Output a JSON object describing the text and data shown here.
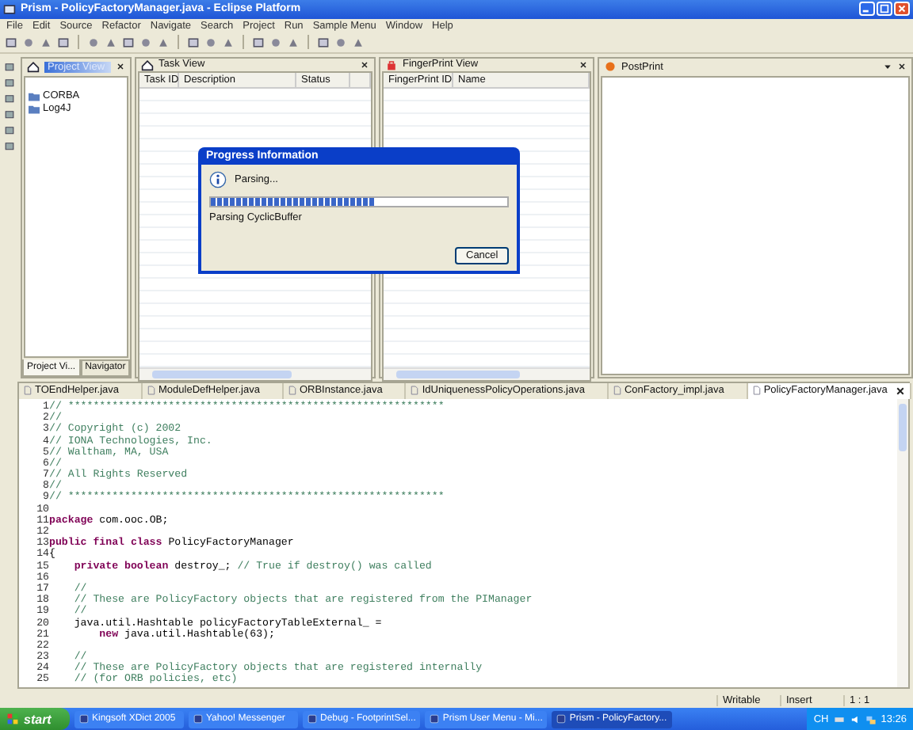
{
  "window": {
    "title": "Prism - PolicyFactoryManager.java - Eclipse Platform"
  },
  "menu": [
    "File",
    "Edit",
    "Source",
    "Refactor",
    "Navigate",
    "Search",
    "Project",
    "Run",
    "Sample Menu",
    "Window",
    "Help"
  ],
  "project_view": {
    "title": "Project View",
    "items": [
      {
        "label": "CORBA"
      },
      {
        "label": "Log4J"
      }
    ],
    "tabs": [
      {
        "label": "Project Vi...",
        "selected": true
      },
      {
        "label": "Navigator",
        "selected": false
      }
    ]
  },
  "task_view": {
    "title": "Task View",
    "columns": [
      "Task ID",
      "Description",
      "Status"
    ]
  },
  "fingerprint_view": {
    "title": "FingerPrint View",
    "columns": [
      "FingerPrint ID",
      "Name"
    ]
  },
  "postprint_view": {
    "title": "PostPrint"
  },
  "editor": {
    "tabs": [
      {
        "label": "TOEndHelper.java",
        "selected": false
      },
      {
        "label": "ModuleDefHelper.java",
        "selected": false
      },
      {
        "label": "ORBInstance.java",
        "selected": false
      },
      {
        "label": "IdUniquenessPolicyOperations.java",
        "selected": false
      },
      {
        "label": "ConFactory_impl.java",
        "selected": false
      },
      {
        "label": "PolicyFactoryManager.java",
        "selected": true
      }
    ],
    "lines": [
      {
        "number": "1",
        "segments": [
          {
            "kind": "comment",
            "text": "// ************************************************************"
          }
        ]
      },
      {
        "number": "2",
        "segments": [
          {
            "kind": "comment",
            "text": "//"
          }
        ]
      },
      {
        "number": "3",
        "segments": [
          {
            "kind": "comment",
            "text": "// Copyright (c) 2002"
          }
        ]
      },
      {
        "number": "4",
        "segments": [
          {
            "kind": "comment",
            "text": "// IONA Technologies, Inc."
          }
        ]
      },
      {
        "number": "5",
        "segments": [
          {
            "kind": "comment",
            "text": "// Waltham, MA, USA"
          }
        ]
      },
      {
        "number": "6",
        "segments": [
          {
            "kind": "comment",
            "text": "//"
          }
        ]
      },
      {
        "number": "7",
        "segments": [
          {
            "kind": "comment",
            "text": "// All Rights Reserved"
          }
        ]
      },
      {
        "number": "8",
        "segments": [
          {
            "kind": "comment",
            "text": "//"
          }
        ]
      },
      {
        "number": "9",
        "segments": [
          {
            "kind": "comment",
            "text": "// ************************************************************"
          }
        ]
      },
      {
        "number": "10"
      },
      {
        "number": "11",
        "segments": [
          {
            "kind": "keyword",
            "text": "package"
          },
          {
            "kind": "plain",
            "text": " com.ooc.OB;"
          }
        ]
      },
      {
        "number": "12"
      },
      {
        "number": "13",
        "segments": [
          {
            "kind": "keyword",
            "text": "public final class"
          },
          {
            "kind": "plain",
            "text": " PolicyFactoryManager"
          }
        ]
      },
      {
        "number": "14",
        "segments": [
          {
            "kind": "plain",
            "text": "{"
          }
        ]
      },
      {
        "number": "15",
        "segments": [
          {
            "kind": "keyword",
            "text": "    private boolean"
          },
          {
            "kind": "plain",
            "text": " destroy_; "
          },
          {
            "kind": "comment",
            "text": "// True if destroy() was called"
          }
        ]
      },
      {
        "number": "16"
      },
      {
        "number": "17",
        "segments": [
          {
            "kind": "comment",
            "text": "    //"
          }
        ]
      },
      {
        "number": "18",
        "segments": [
          {
            "kind": "comment",
            "text": "    // These are PolicyFactory objects that are registered from the PIManager"
          }
        ]
      },
      {
        "number": "19",
        "segments": [
          {
            "kind": "comment",
            "text": "    //"
          }
        ]
      },
      {
        "number": "20",
        "segments": [
          {
            "kind": "plain",
            "text": "    java.util.Hashtable policyFactoryTableExternal_ ="
          }
        ]
      },
      {
        "number": "21",
        "segments": [
          {
            "kind": "keyword",
            "text": "        new"
          },
          {
            "kind": "plain",
            "text": " java.util.Hashtable(63);"
          }
        ]
      },
      {
        "number": "22"
      },
      {
        "number": "23",
        "segments": [
          {
            "kind": "comment",
            "text": "    //"
          }
        ]
      },
      {
        "number": "24",
        "segments": [
          {
            "kind": "comment",
            "text": "    // These are PolicyFactory objects that are registered internally"
          }
        ]
      },
      {
        "number": "25",
        "segments": [
          {
            "kind": "comment",
            "text": "    // (for ORB policies, etc)"
          }
        ]
      }
    ]
  },
  "status_bar": [
    "Writable",
    "Insert",
    "1 : 1"
  ],
  "dialog": {
    "title": "Progress Information",
    "message": "Parsing...",
    "level": 0.55,
    "detail": "Parsing CyclicBuffer",
    "buttons": [
      "Cancel"
    ]
  },
  "taskbar": {
    "start": "start",
    "items": [
      {
        "label": "Kingsoft XDict 2005",
        "selected": false
      },
      {
        "label": "Yahoo! Messenger",
        "selected": false
      },
      {
        "label": "Debug - FootprintSel...",
        "selected": false
      },
      {
        "label": "Prism User Menu - Mi...",
        "selected": false
      },
      {
        "label": "Prism - PolicyFactory...",
        "selected": true
      }
    ],
    "tray": [
      "CH"
    ],
    "clock": "13:26"
  }
}
